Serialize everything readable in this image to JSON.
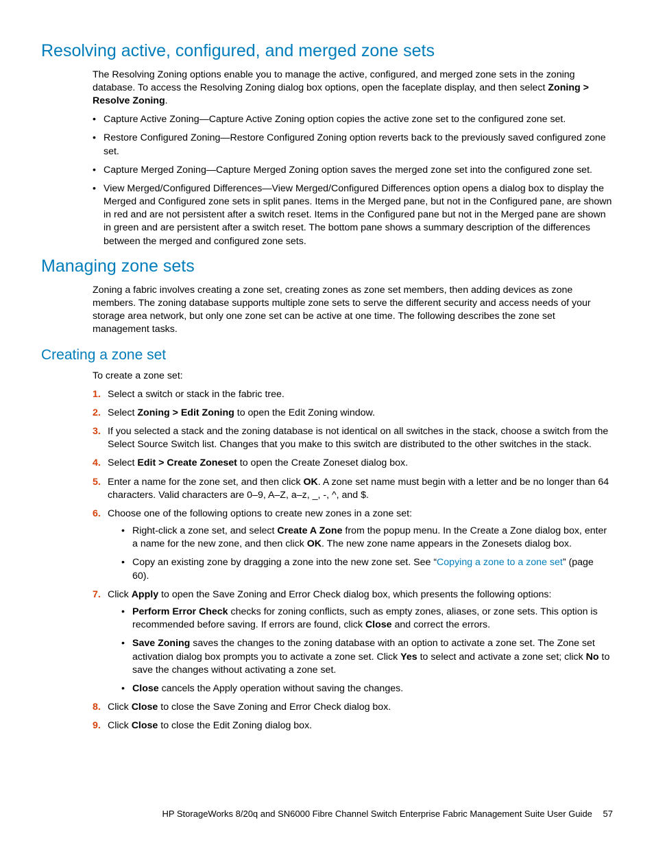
{
  "h2_resolving": "Resolving active, configured, and merged zone sets",
  "resolving_intro_a": "The Resolving Zoning options enable you to manage the active, configured, and merged zone sets in the zoning database. To access the Resolving Zoning dialog box options, open the faceplate display, and then select ",
  "resolving_intro_b": "Zoning > Resolve Zoning",
  "resolving_intro_c": ".",
  "resolving_items": [
    "Capture Active Zoning—Capture Active Zoning option copies the active zone set to the configured zone set.",
    "Restore Configured Zoning—Restore Configured Zoning option reverts back to the previously saved configured zone set.",
    "Capture Merged Zoning—Capture Merged Zoning option saves the merged zone set into the configured zone set.",
    "View Merged/Configured Differences—View Merged/Configured Differences option opens a dialog box to display the Merged and Configured zone sets in split panes. Items in the Merged pane, but not in the Configured pane, are shown in red and are not persistent after a switch reset. Items in the Configured pane but not in the Merged pane are shown in green and are persistent after a switch reset. The bottom pane shows a summary description of the differences between the merged and configured zone sets."
  ],
  "h2_managing": "Managing zone sets",
  "managing_para": "Zoning a fabric involves creating a zone set, creating zones as zone set members, then adding devices as zone members. The zoning database supports multiple zone sets to serve the different security and access needs of your storage area network, but only one zone set can be active at one time. The following describes the zone set management tasks.",
  "h3_creating": "Creating a zone set",
  "creating_intro": "To create a zone set:",
  "step1": "Select a switch or stack in the fabric tree.",
  "step2_a": "Select ",
  "step2_b": "Zoning > Edit Zoning",
  "step2_c": " to open the Edit Zoning window.",
  "step3": "If you selected a stack and the zoning database is not identical on all switches in the stack, choose a switch from the Select Source Switch list. Changes that you make to this switch are distributed to the other switches in the stack.",
  "step4_a": "Select ",
  "step4_b": "Edit > Create Zoneset",
  "step4_c": " to open the Create Zoneset dialog box.",
  "step5_a": "Enter a name for the zone set, and then click ",
  "step5_b": "OK",
  "step5_c": ". A zone set name must begin with a letter and be no longer than 64 characters. Valid characters are 0–9, A–Z, a–z, _, -, ^, and $.",
  "step6": "Choose one of the following options to create new zones in a zone set:",
  "step6_sub1_a": "Right-click a zone set, and select ",
  "step6_sub1_b": "Create A Zone",
  "step6_sub1_c": " from the popup menu. In the Create a Zone dialog box, enter a name for the new zone, and then click ",
  "step6_sub1_d": "OK",
  "step6_sub1_e": ". The new zone name appears in the Zonesets dialog box.",
  "step6_sub2_a": "Copy an existing zone by dragging a zone into the new zone set. See “",
  "step6_sub2_link": "Copying a zone to a zone set",
  "step6_sub2_b": "” (page 60).",
  "step7_a": "Click ",
  "step7_b": "Apply",
  "step7_c": " to open the Save Zoning and Error Check dialog box, which presents the following options:",
  "step7_sub1_a": "Perform Error Check",
  "step7_sub1_b": " checks for zoning conflicts, such as empty zones, aliases, or zone sets. This option is recommended before saving. If errors are found, click ",
  "step7_sub1_c": "Close",
  "step7_sub1_d": " and correct the errors.",
  "step7_sub2_a": "Save Zoning",
  "step7_sub2_b": " saves the changes to the zoning database with an option to activate a zone set. The Zone set activation dialog box prompts you to activate a zone set. Click ",
  "step7_sub2_c": "Yes",
  "step7_sub2_d": " to select and activate a zone set; click ",
  "step7_sub2_e": "No",
  "step7_sub2_f": " to save the changes without activating a zone set.",
  "step7_sub3_a": "Close",
  "step7_sub3_b": " cancels the Apply operation without saving the changes.",
  "step8_a": "Click ",
  "step8_b": "Close",
  "step8_c": " to close the Save Zoning and Error Check dialog box.",
  "step9_a": "Click ",
  "step9_b": "Close",
  "step9_c": " to close the Edit Zoning dialog box.",
  "footer_title": "HP StorageWorks 8/20q and SN6000 Fibre Channel Switch Enterprise Fabric Management Suite User Guide",
  "footer_page": "57"
}
